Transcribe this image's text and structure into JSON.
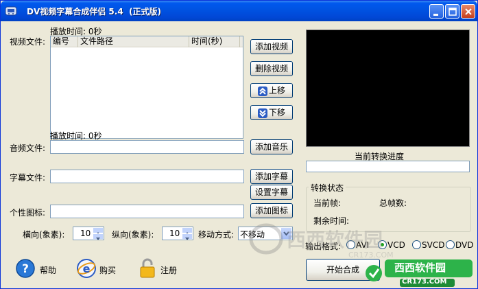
{
  "window": {
    "title": "DV视频字幕合成伴侣 5.4  (正式版)"
  },
  "video_section": {
    "play_time": "播放时间: 0秒",
    "label": "视频文件:",
    "columns": [
      "编号",
      "文件路径",
      "时间(秒)"
    ],
    "add_button": "添加视频",
    "delete_button": "删除视频",
    "up_button": "上移",
    "down_button": "下移"
  },
  "audio_section": {
    "play_time": "播放时间: 0秒",
    "label": "音频文件:",
    "value": "",
    "add_button": "添加音乐"
  },
  "subtitle_section": {
    "label": "字幕文件:",
    "value": "",
    "add_button": "添加字幕",
    "settings_button": "设置字幕"
  },
  "logo_section": {
    "label": "个性图标:",
    "value": "",
    "add_button": "添加图标"
  },
  "position": {
    "horizontal_label": "横向(象素):",
    "horizontal_value": "10",
    "vertical_label": "纵向(象素):",
    "vertical_value": "10",
    "move_label": "移动方式:",
    "move_value": "不移动"
  },
  "progress": {
    "label": "当前转换进度",
    "value": 0
  },
  "status": {
    "group_title": "转换状态",
    "current_frame_label": "当前帧:",
    "total_frames_label": "总帧数:",
    "remaining_label": "剩余时间:"
  },
  "output": {
    "label": "输出格式:",
    "options": [
      "AVI",
      "VCD",
      "SVCD",
      "DVD"
    ],
    "selected": "VCD"
  },
  "actions": {
    "help": "帮助",
    "buy": "购买",
    "register": "注册",
    "start": "开始合成"
  },
  "brand": {
    "name": "西西软件园",
    "sub": "CR173.COM"
  },
  "colors": {
    "titlebar": "#0054E3",
    "window_bg": "#ECE9D8",
    "preview_bg": "#000000"
  }
}
